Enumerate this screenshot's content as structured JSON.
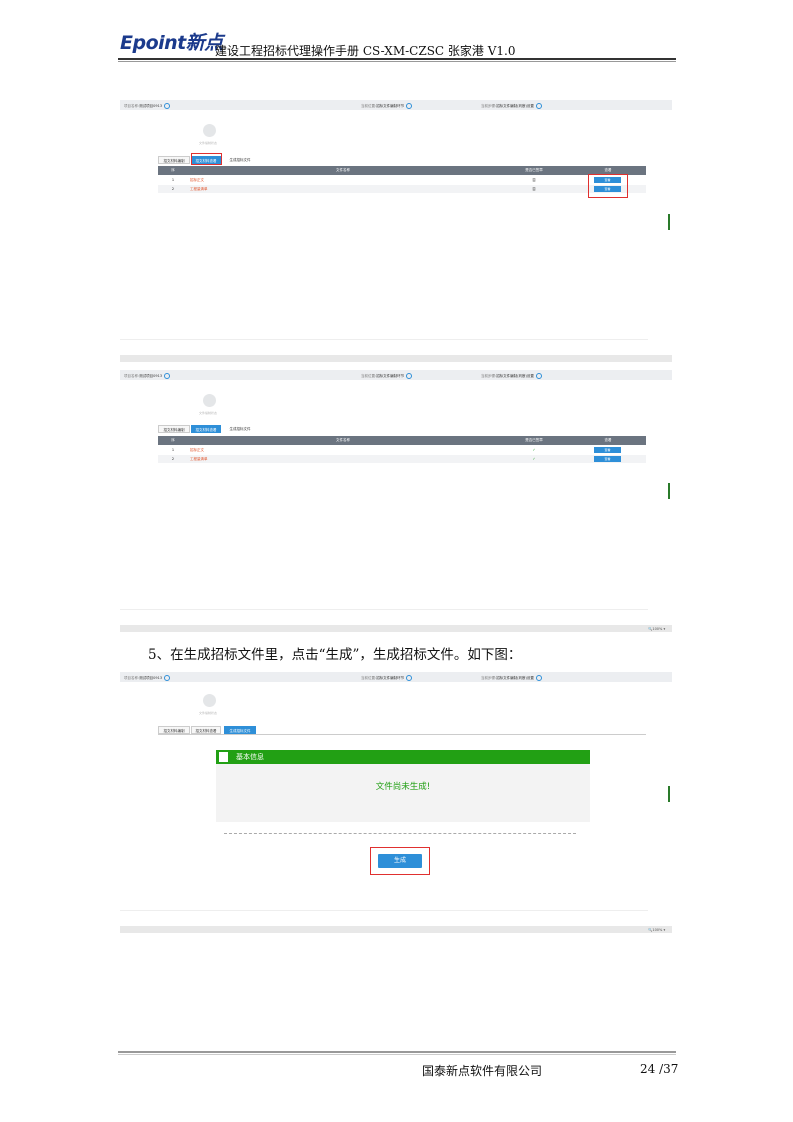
{
  "header": {
    "logo": "Epoint新点",
    "title": "建设工程招标代理操作手册 CS-XM-CZSC 张家港 V1.0"
  },
  "shot1": {
    "info": {
      "project_label": "项目名称:",
      "project_value": "测试项目0913",
      "location_label": "当前位置:",
      "location_value": "招标文件编制环节",
      "status_label": "当前步骤:",
      "status_value": "招标文件编制(判断)设置"
    },
    "cam_label": "文件编制状态",
    "tabs": [
      "招文材料编制",
      "招文材料查看",
      "生成招标文件"
    ],
    "columns": [
      "序",
      "文件名称",
      "是否已签章",
      "查看"
    ],
    "rows": [
      {
        "no": "1",
        "name": "招标正文",
        "signed": "否",
        "btn": "查看"
      },
      {
        "no": "2",
        "name": "工程量清单",
        "signed": "否",
        "btn": "查看"
      }
    ]
  },
  "shot2": {
    "info": {
      "project_label": "项目名称:",
      "project_value": "测试项目0913",
      "location_label": "当前位置:",
      "location_value": "招标文件编制环节",
      "status_label": "当前步骤:",
      "status_value": "招标文件编制(判断)设置"
    },
    "cam_label": "文件编制状态",
    "tabs": [
      "招文材料编制",
      "招文材料查看",
      "生成招标文件"
    ],
    "columns": [
      "序",
      "文件名称",
      "是否已签章",
      "查看"
    ],
    "rows": [
      {
        "no": "1",
        "name": "招标正文",
        "signed": "✓",
        "btn": "查看"
      },
      {
        "no": "2",
        "name": "工程量清单",
        "signed": "✓",
        "btn": "查看"
      }
    ],
    "zoom": "🔍100% ▾"
  },
  "step_text": "5、在生成招标文件里，点击“生成”，生成招标文件。如下图：",
  "shot3": {
    "info": {
      "project_label": "项目名称:",
      "project_value": "测试项目0913",
      "location_label": "当前位置:",
      "location_value": "招标文件编制环节",
      "status_label": "当前步骤:",
      "status_value": "招标文件编制(判断)设置"
    },
    "cam_label": "文件编制状态",
    "tabs": [
      "招文材料编制",
      "招文材料查看",
      "生成招标文件"
    ],
    "panel_title": "基本信息",
    "not_generated": "文件尚未生成!",
    "generate_btn": "生成",
    "zoom": "🔍100% ▾"
  },
  "footer": {
    "company": "国泰新点软件有限公司",
    "page": "24 /37"
  },
  "colors": {
    "accent_blue": "#2e8fd8",
    "panel_green": "#22a014",
    "highlight_red": "#e0302f",
    "link_orange": "#e2552d"
  }
}
